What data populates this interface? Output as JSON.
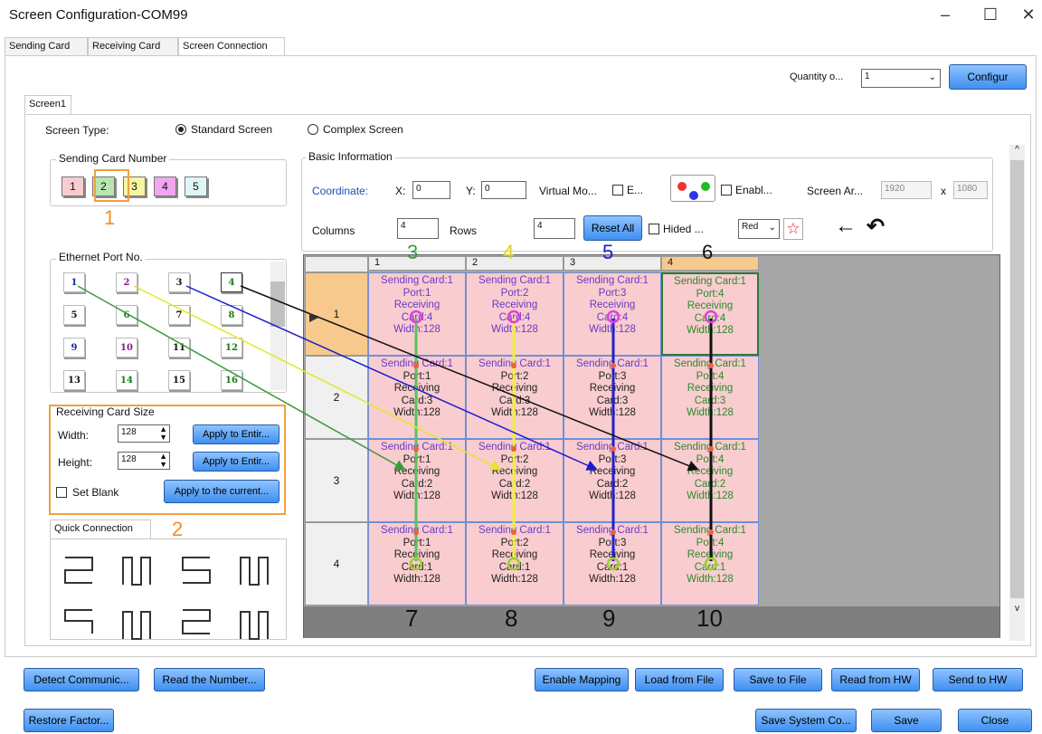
{
  "window": {
    "title": "Screen Configuration-COM99"
  },
  "tabs": [
    {
      "label": "Sending Card"
    },
    {
      "label": "Receiving Card"
    },
    {
      "label": "Screen Connection"
    }
  ],
  "top": {
    "quantity_label": "Quantity o...",
    "quantity_value": "1",
    "configure_label": "Configur"
  },
  "screen_tab": "Screen1",
  "screen_type": {
    "label": "Screen Type:",
    "standard": "Standard Screen",
    "complex": "Complex Screen",
    "selected": "standard"
  },
  "sending_card": {
    "title": "Sending Card Number",
    "items": [
      "1",
      "2",
      "3",
      "4",
      "5"
    ],
    "colors": [
      "#f9cccf",
      "#b9e6b0",
      "#f7f59f",
      "#f1a6ef",
      "#dff6f6"
    ]
  },
  "ethernet": {
    "title": "Ethernet Port No.",
    "ports": [
      "1",
      "2",
      "3",
      "4",
      "5",
      "6",
      "7",
      "8",
      "9",
      "10",
      "11",
      "12",
      "13",
      "14",
      "15",
      "16"
    ],
    "colors": [
      "#1b2aa0",
      "#8a1a8a",
      "#111111",
      "#1a7a1a",
      "#111111",
      "#1a7a1a",
      "#111111",
      "#1a7a1a",
      "#1b2aa0",
      "#8a1a8a",
      "#111111",
      "#1a7a1a",
      "#111111",
      "#1a7a1a",
      "#111111",
      "#1a7a1a"
    ]
  },
  "receiving_size": {
    "title": "Receiving Card Size",
    "width_label": "Width:",
    "width_value": "128",
    "height_label": "Height:",
    "height_value": "128",
    "apply1": "Apply to Entir...",
    "apply2": "Apply to Entir...",
    "set_blank": "Set Blank",
    "apply_current": "Apply to the current..."
  },
  "quick": {
    "title": "Quick Connection"
  },
  "basic": {
    "title": "Basic Information",
    "coordinate": "Coordinate:",
    "x_label": "X:",
    "x_value": "0",
    "y_label": "Y:",
    "y_value": "0",
    "virtual": "Virtual Mo...",
    "e_label": "E...",
    "enable": "Enabl...",
    "screen_area": "Screen Ar...",
    "area_w": "1920",
    "x_sep": "x",
    "area_h": "1080",
    "columns_label": "Columns",
    "columns_value": "4",
    "rows_label": "Rows",
    "rows_value": "4",
    "reset_all": "Reset All",
    "hided": "Hided ...",
    "color_select": "Red"
  },
  "grid": {
    "col_headers": [
      "1",
      "2",
      "3",
      "4"
    ],
    "row_headers": [
      "1",
      "2",
      "3",
      "4"
    ],
    "rows": [
      [
        [
          "Sending Card:1",
          "Port:1",
          "Receiving",
          "Card:4",
          "Width:128"
        ],
        [
          "Sending Card:1",
          "Port:2",
          "Receiving",
          "Card:4",
          "Width:128"
        ],
        [
          "Sending Card:1",
          "Port:3",
          "Receiving",
          "Card:4",
          "Width:128"
        ],
        [
          "Sending Card:1",
          "Port:4",
          "Receiving",
          "Card:4",
          "Width:128"
        ]
      ],
      [
        [
          "Sending Card:1",
          "Port:1",
          "Receiving",
          "Card:3",
          "Width:128"
        ],
        [
          "Sending Card:1",
          "Port:2",
          "Receiving",
          "Card:3",
          "Width:128"
        ],
        [
          "Sending Card:1",
          "Port:3",
          "Receiving",
          "Card:3",
          "Width:128"
        ],
        [
          "Sending Card:1",
          "Port:4",
          "Receiving",
          "Card:3",
          "Width:128"
        ]
      ],
      [
        [
          "Sending Card:1",
          "Port:1",
          "Receiving",
          "Card:2",
          "Width:128"
        ],
        [
          "Sending Card:1",
          "Port:2",
          "Receiving",
          "Card:2",
          "Width:128"
        ],
        [
          "Sending Card:1",
          "Port:3",
          "Receiving",
          "Card:2",
          "Width:128"
        ],
        [
          "Sending Card:1",
          "Port:4",
          "Receiving",
          "Card:2",
          "Width:128"
        ]
      ],
      [
        [
          "Sending Card:1",
          "Port:1",
          "Receiving",
          "Card:1",
          "Width:128"
        ],
        [
          "Sending Card:1",
          "Port:2",
          "Receiving",
          "Card:1",
          "Width:128"
        ],
        [
          "Sending Card:1",
          "Port:3",
          "Receiving",
          "Card:1",
          "Width:128"
        ],
        [
          "Sending Card:1",
          "Port:4",
          "Receiving",
          "Card:1",
          "Width:128"
        ]
      ]
    ]
  },
  "annotations": {
    "n1": "1",
    "n2": "2",
    "n3": "3",
    "n4": "4",
    "n5": "5",
    "n6": "6",
    "n7": "7",
    "n8": "8",
    "n9": "9",
    "n10": "10"
  },
  "bottom": {
    "detect": "Detect Communic...",
    "read_number": "Read the Number...",
    "enable_mapping": "Enable Mapping",
    "load_file": "Load from File",
    "save_file": "Save to File",
    "read_hw": "Read from HW",
    "send_hw": "Send to HW",
    "restore": "Restore Factor...",
    "save_system": "Save System Co...",
    "save": "Save",
    "close": "Close"
  }
}
